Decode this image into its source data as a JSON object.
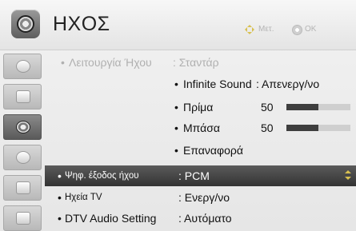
{
  "header": {
    "title": "ΗΧΟΣ",
    "hint_move": "Μετ.",
    "hint_ok": "OK"
  },
  "menu": [
    {
      "label": "Λειτουργία Ήχου",
      "value": ": Σταντάρ",
      "state": "disabled"
    },
    {
      "label": "Infinite Sound",
      "value": ": Απενεργ/νο",
      "state": "sub"
    },
    {
      "label": "Πρίμα",
      "value": "50",
      "level": 0.5,
      "state": "sub"
    },
    {
      "label": "Μπάσα",
      "value": "50",
      "level": 0.5,
      "state": "sub"
    },
    {
      "label": "Επαναφορά",
      "state": "sub"
    },
    {
      "label": "Ψηφ. έξοδος ήχου",
      "value": ": PCM",
      "state": "selected"
    },
    {
      "label": "Ηχεία TV",
      "value": ": Ενεργ/νο",
      "state": "normal"
    },
    {
      "label": "DTV Audio Setting",
      "value": ": Αυτόματο",
      "state": "normal"
    }
  ],
  "colors": {
    "selected_bg": "#3a3a3a",
    "accent": "#d8c050",
    "disabled_text": "#b0b0b0"
  }
}
